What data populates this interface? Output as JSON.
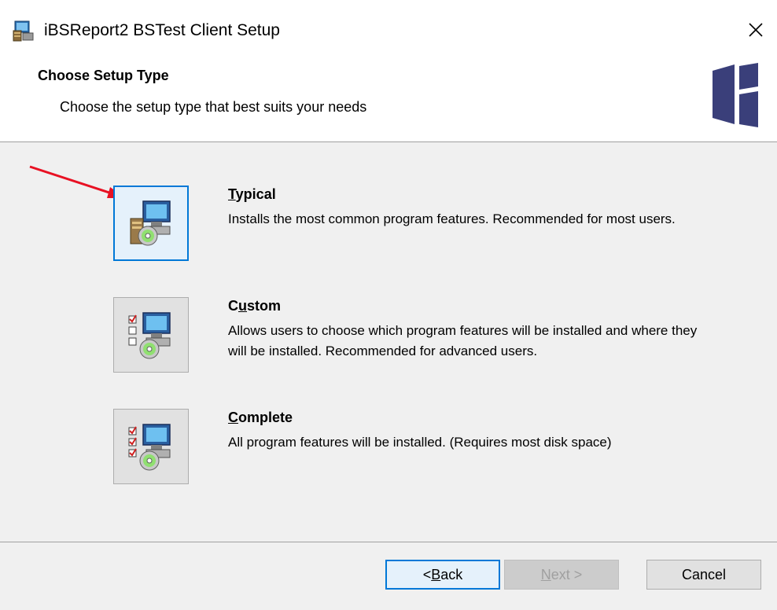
{
  "window": {
    "title": "iBSReport2 BSTest Client Setup"
  },
  "banner": {
    "title": "Choose Setup Type",
    "subtitle": "Choose the setup type that best suits your needs"
  },
  "options": [
    {
      "label_pre": "",
      "label_accel": "T",
      "label_post": "ypical",
      "description": "Installs the most common program features. Recommended for most users.",
      "icon": "typical-setup-icon",
      "focused": true
    },
    {
      "label_pre": "C",
      "label_accel": "u",
      "label_post": "stom",
      "description": "Allows users to choose which program features will be installed and where they will be installed. Recommended for advanced users.",
      "icon": "custom-setup-icon",
      "focused": false
    },
    {
      "label_pre": "",
      "label_accel": "C",
      "label_post": "omplete",
      "description": "All program features will be installed.  (Requires most disk space)",
      "icon": "complete-setup-icon",
      "focused": false
    }
  ],
  "footer": {
    "back_pre": "< ",
    "back_accel": "B",
    "back_post": "ack",
    "next_accel": "N",
    "next_post": "ext >",
    "cancel": "Cancel"
  },
  "colors": {
    "focus_border": "#0078d7",
    "annotation_arrow": "#e81123",
    "logo": "#3a3f7a"
  }
}
